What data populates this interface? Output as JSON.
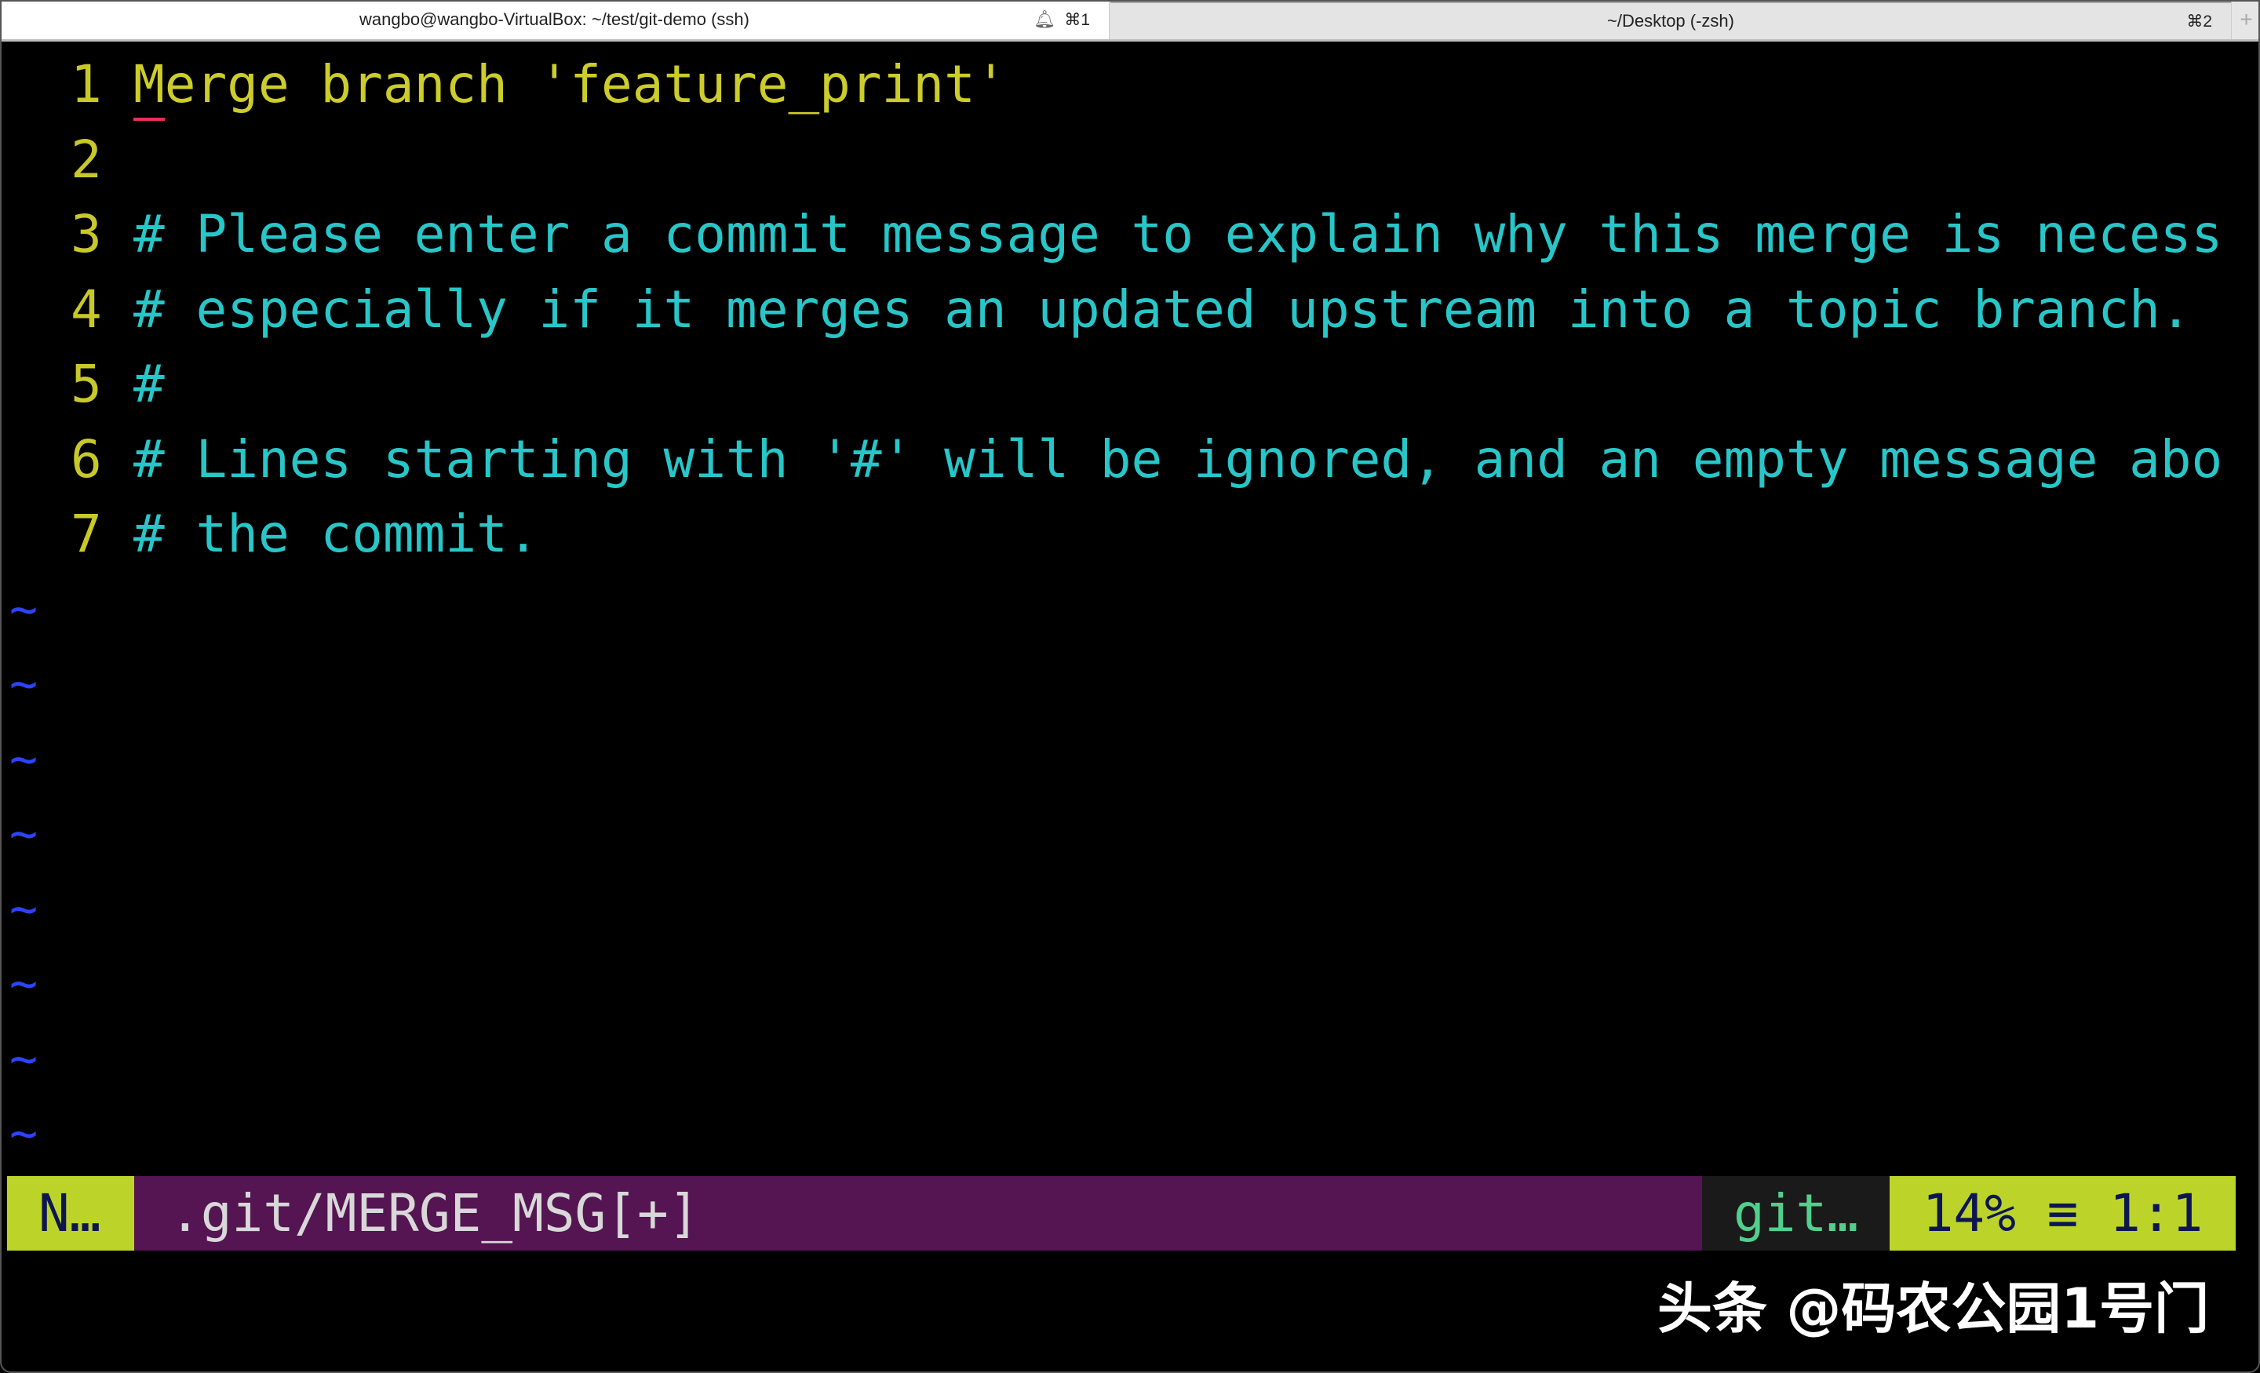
{
  "tabs": [
    {
      "title": "wangbo@wangbo-VirtualBox: ~/test/git-demo (ssh)",
      "shortcut": "⌘1",
      "active": true,
      "bell_icon": "bell-icon"
    },
    {
      "title": "~/Desktop (-zsh)",
      "shortcut": "⌘2",
      "active": false
    }
  ],
  "new_tab_label": "+",
  "editor": {
    "lines": [
      {
        "num": "1",
        "text": "Merge branch 'feature_print'",
        "kind": "message"
      },
      {
        "num": "2",
        "text": "",
        "kind": "message"
      },
      {
        "num": "3",
        "text": "# Please enter a commit message to explain why this merge is necess",
        "kind": "comment"
      },
      {
        "num": "4",
        "text": "# especially if it merges an updated upstream into a topic branch.",
        "kind": "comment"
      },
      {
        "num": "5",
        "text": "#",
        "kind": "comment"
      },
      {
        "num": "6",
        "text": "# Lines starting with '#' will be ignored, and an empty message abo",
        "kind": "comment"
      },
      {
        "num": "7",
        "text": "# the commit.",
        "kind": "comment"
      }
    ],
    "tilde": "~",
    "tilde_count": 8
  },
  "statusline": {
    "mode": "N…",
    "file": ".git/MERGE_MSG[+]",
    "filetype": "git…",
    "position": "14% ≡  1:1"
  },
  "watermark": "头条 @码农公园1号门",
  "colors": {
    "line_number": "#c8c82a",
    "message": "#cccc2c",
    "comment": "#28c6c8",
    "tilde": "#2c44ff",
    "mode_bg": "#bcd42a",
    "file_bg": "#541552",
    "filetype_fg": "#52cf8c"
  }
}
